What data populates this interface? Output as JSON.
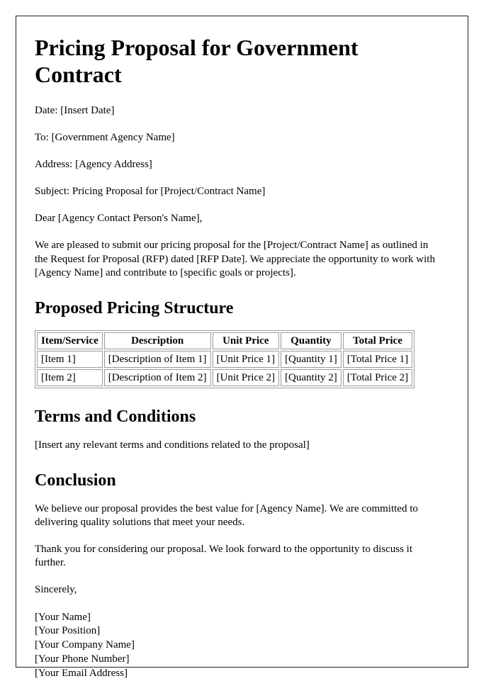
{
  "document": {
    "title": "Pricing Proposal for Government Contract",
    "header_fields": [
      "Date: [Insert Date]",
      "To: [Government Agency Name]",
      "Address: [Agency Address]",
      "Subject: Pricing Proposal for [Project/Contract Name]",
      "Dear [Agency Contact Person's Name],"
    ],
    "intro_paragraph": "We are pleased to submit our pricing proposal for the [Project/Contract Name] as outlined in the Request for Proposal (RFP) dated [RFP Date]. We appreciate the opportunity to work with [Agency Name] and contribute to [specific goals or projects].",
    "pricing_section": {
      "heading": "Proposed Pricing Structure",
      "table": {
        "columns": [
          "Item/Service",
          "Description",
          "Unit Price",
          "Quantity",
          "Total Price"
        ],
        "rows": [
          [
            "[Item 1]",
            "[Description of Item 1]",
            "[Unit Price 1]",
            "[Quantity 1]",
            "[Total Price 1]"
          ],
          [
            "[Item 2]",
            "[Description of Item 2]",
            "[Unit Price 2]",
            "[Quantity 2]",
            "[Total Price 2]"
          ]
        ]
      }
    },
    "terms_section": {
      "heading": "Terms and Conditions",
      "body": "[Insert any relevant terms and conditions related to the proposal]"
    },
    "conclusion_section": {
      "heading": "Conclusion",
      "paragraph_1": "We believe our proposal provides the best value for [Agency Name]. We are committed to delivering quality solutions that meet your needs.",
      "paragraph_2": "Thank you for considering our proposal. We look forward to the opportunity to discuss it further.",
      "closing": "Sincerely,"
    },
    "signature_lines": [
      "[Your Name]",
      "[Your Position]",
      "[Your Company Name]",
      "[Your Phone Number]",
      "[Your Email Address]"
    ]
  }
}
